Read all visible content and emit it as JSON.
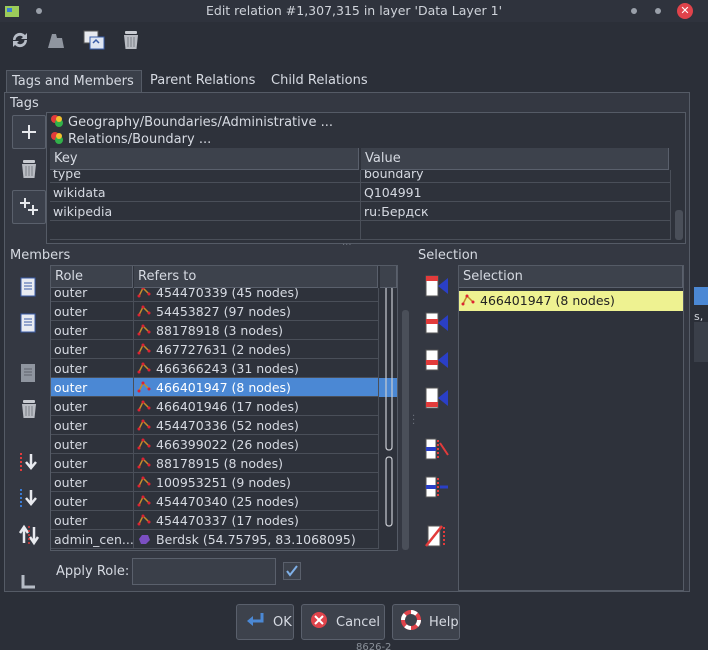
{
  "window": {
    "title": "Edit relation #1,307,315 in layer 'Data Layer 1'"
  },
  "tabs": [
    {
      "label": "Tags and Members",
      "active": true
    },
    {
      "label": "Parent Relations",
      "active": false
    },
    {
      "label": "Child Relations",
      "active": false
    }
  ],
  "tags": {
    "section_label": "Tags",
    "presets": [
      "Geography/Boundaries/Administrative ...",
      "Relations/Boundary ..."
    ],
    "columns": [
      "Key",
      "Value"
    ],
    "rows": [
      {
        "key": "type",
        "value": "boundary"
      },
      {
        "key": "wikidata",
        "value": "Q104991"
      },
      {
        "key": "wikipedia",
        "value": "ru:Бердск"
      }
    ]
  },
  "members": {
    "section_label": "Members",
    "columns": [
      "Role",
      "Refers to"
    ],
    "rows": [
      {
        "role": "outer",
        "ref": "454470339 (45 nodes)",
        "selected": false
      },
      {
        "role": "outer",
        "ref": "54453827 (97 nodes)",
        "selected": false
      },
      {
        "role": "outer",
        "ref": "88178918 (3 nodes)",
        "selected": false
      },
      {
        "role": "outer",
        "ref": "467727631 (2 nodes)",
        "selected": false
      },
      {
        "role": "outer",
        "ref": "466366243 (31 nodes)",
        "selected": false
      },
      {
        "role": "outer",
        "ref": "466401947 (8 nodes)",
        "selected": true
      },
      {
        "role": "outer",
        "ref": "466401946 (17 nodes)",
        "selected": false
      },
      {
        "role": "outer",
        "ref": "454470336 (52 nodes)",
        "selected": false
      },
      {
        "role": "outer",
        "ref": "466399022 (26 nodes)",
        "selected": false
      },
      {
        "role": "outer",
        "ref": "88178915 (8 nodes)",
        "selected": false
      },
      {
        "role": "outer",
        "ref": "100953251 (9 nodes)",
        "selected": false
      },
      {
        "role": "outer",
        "ref": "454470340 (25 nodes)",
        "selected": false
      },
      {
        "role": "outer",
        "ref": "454470337 (17 nodes)",
        "selected": false
      },
      {
        "role": "admin_cen...",
        "ref": "Berdsk (54.75795, 83.1068095)",
        "selected": false
      }
    ],
    "apply_role_label": "Apply Role:",
    "apply_role_value": "",
    "apply_role_checked": true
  },
  "selection": {
    "section_label": "Selection",
    "column": "Selection",
    "rows": [
      "466401947 (8 nodes)"
    ]
  },
  "buttons": {
    "ok": "OK",
    "cancel": "Cancel",
    "help": "Help"
  },
  "background_peek": {
    "top_right": "s,",
    "bottom": "8626-2"
  }
}
